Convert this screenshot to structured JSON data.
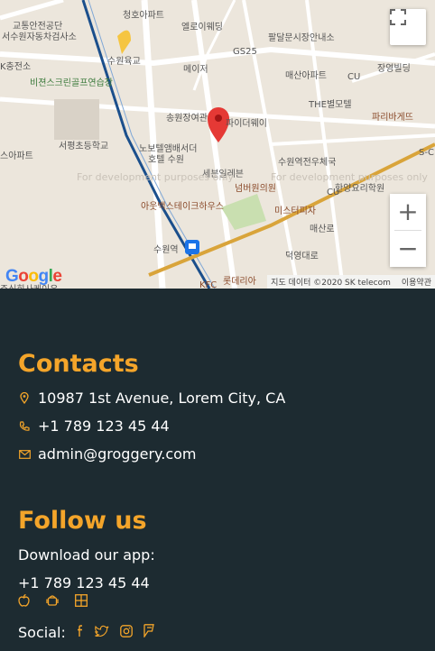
{
  "map": {
    "labels": [
      {
        "text": "청호아파트",
        "cls": ""
      },
      {
        "text": "엘로이웨딩",
        "cls": ""
      },
      {
        "text": "교통안전공단",
        "cls": ""
      },
      {
        "text": "서수원자동차검사소",
        "cls": ""
      },
      {
        "text": "수원육교",
        "cls": ""
      },
      {
        "text": "팔달문시장안내소",
        "cls": ""
      },
      {
        "text": "GS25",
        "cls": ""
      },
      {
        "text": "메이저",
        "cls": ""
      },
      {
        "text": "K충전소",
        "cls": ""
      },
      {
        "text": "매산아파트",
        "cls": ""
      },
      {
        "text": "장영빌딩",
        "cls": ""
      },
      {
        "text": "비젼스크린골프연습장",
        "cls": "green"
      },
      {
        "text": "CU",
        "cls": ""
      },
      {
        "text": "THE별모텔",
        "cls": ""
      },
      {
        "text": "송원장여관",
        "cls": ""
      },
      {
        "text": "파이더웨이",
        "cls": ""
      },
      {
        "text": "파리바게뜨",
        "cls": "brown"
      },
      {
        "text": "서평초등학교",
        "cls": ""
      },
      {
        "text": "노보텔앰배서더",
        "cls": ""
      },
      {
        "text": "호텔 수원",
        "cls": ""
      },
      {
        "text": "스아파트",
        "cls": ""
      },
      {
        "text": "수원역전우체국",
        "cls": ""
      },
      {
        "text": "S-C",
        "cls": ""
      },
      {
        "text": "세븐일레븐",
        "cls": ""
      },
      {
        "text": "넘버원의원",
        "cls": "brown"
      },
      {
        "text": "한양요리학원",
        "cls": ""
      },
      {
        "text": "CU",
        "cls": ""
      },
      {
        "text": "아웃백스테이크하우스",
        "cls": "brown"
      },
      {
        "text": "미스터피자",
        "cls": "brown"
      },
      {
        "text": "수원역",
        "cls": ""
      },
      {
        "text": "매산로",
        "cls": ""
      },
      {
        "text": "덕영대로",
        "cls": ""
      },
      {
        "text": "롯데리아",
        "cls": "brown"
      },
      {
        "text": "KFC",
        "cls": "brown"
      },
      {
        "text": "주식회사케이유",
        "cls": ""
      },
      {
        "text": "For development purposes only",
        "cls": "faint"
      },
      {
        "text": "For development purposes only",
        "cls": "faint"
      }
    ],
    "google_logo": "Google",
    "attribution": "지도 데이터 ©2020 SK telecom",
    "terms": "이용약관",
    "zoom_in": "+",
    "zoom_out": "−",
    "accent_pin": "#e53935"
  },
  "contacts": {
    "title": "Contacts",
    "address": "10987 1st Avenue, Lorem City, CA",
    "phone": "+1 789 123 45 44",
    "email": "admin@groggery.com"
  },
  "follow": {
    "title": "Follow us",
    "download_label": "Download our app:",
    "phone": "+1 789 123 45 44",
    "app_icons": [
      "apple-icon",
      "android-icon",
      "windows-icon"
    ],
    "social_label": "Social:",
    "social_icons": [
      "facebook-icon",
      "twitter-icon",
      "instagram-icon",
      "foursquare-icon"
    ]
  },
  "colors": {
    "accent": "#f4a52a",
    "footer_bg": "#1d2b31"
  }
}
